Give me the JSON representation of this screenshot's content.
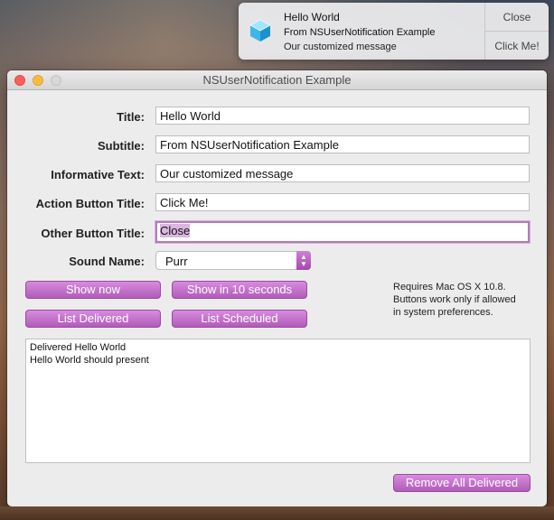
{
  "notification": {
    "title": "Hello World",
    "subtitle": "From NSUserNotification Example",
    "informative": "Our customized message",
    "close_label": "Close",
    "action_label": "Click Me!"
  },
  "window": {
    "title": "NSUserNotification Example"
  },
  "form": {
    "fields": [
      {
        "label": "Title:",
        "value": "Hello World"
      },
      {
        "label": "Subtitle:",
        "value": "From NSUserNotification Example"
      },
      {
        "label": "Informative Text:",
        "value": "Our customized message"
      },
      {
        "label": "Action Button Title:",
        "value": "Click Me!"
      },
      {
        "label": "Other Button Title:",
        "value": "Close"
      }
    ],
    "sound": {
      "label": "Sound Name:",
      "value": "Purr"
    }
  },
  "buttons": {
    "show_now": "Show now",
    "show_in_10": "Show in 10 seconds",
    "list_delivered": "List Delivered",
    "list_scheduled": "List Scheduled",
    "remove_all": "Remove All Delivered"
  },
  "note": {
    "line1": "Requires Mac OS X 10.8.",
    "line2": "Buttons work only if allowed",
    "line3": "in system preferences."
  },
  "log": {
    "lines": [
      "Delivered Hello World",
      "Hello World should present"
    ]
  },
  "colors": {
    "accent": "#c070c8",
    "focus_ring": "#b27bbd"
  },
  "icons": {
    "app": "cube-app-icon"
  }
}
